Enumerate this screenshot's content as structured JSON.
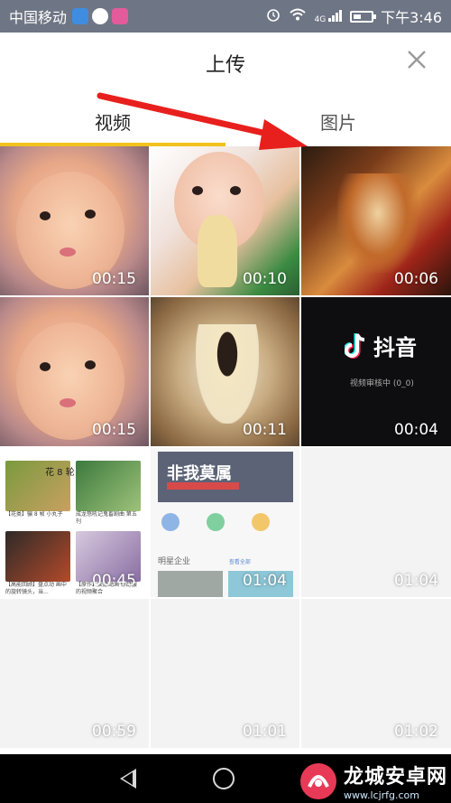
{
  "status_bar": {
    "carrier": "中国移动",
    "time": "下午3:46",
    "network": "4G",
    "icons": [
      "alarm-icon",
      "wifi-icon",
      "signal-icon",
      "battery-icon"
    ],
    "app_icons": [
      "maps-app-icon",
      "chat-app-icon",
      "photo-app-icon"
    ]
  },
  "sheet": {
    "title": "上传",
    "close_icon": "close-icon",
    "tabs": [
      {
        "label": "视频",
        "active": true
      },
      {
        "label": "图片",
        "active": false
      }
    ],
    "accent_color": "#f2c11e",
    "annotation_arrow_color": "#e8201d"
  },
  "videos": [
    {
      "thumb": "baby-face",
      "duration": "00:15"
    },
    {
      "thumb": "baby-banana",
      "duration": "00:10"
    },
    {
      "thumb": "anime-character",
      "duration": "00:06"
    },
    {
      "thumb": "baby-face",
      "duration": "00:15"
    },
    {
      "thumb": "sleeping-baby",
      "duration": "00:11"
    },
    {
      "thumb": "douyin-splash",
      "duration": "00:04"
    },
    {
      "thumb": "app-screenshot-video-list",
      "duration": "00:45"
    },
    {
      "thumb": "app-screenshot-home",
      "duration": "01:04"
    },
    {
      "thumb": "blank",
      "duration": "01:04"
    },
    {
      "thumb": "blank",
      "duration": "00:59"
    },
    {
      "thumb": "blank",
      "duration": "01:01"
    },
    {
      "thumb": "blank",
      "duration": "01:02"
    }
  ],
  "douyin": {
    "name": "抖音",
    "status": "视频审核中 (0_0)"
  },
  "app_screenshot_1": {
    "tag": "花 8 轮",
    "captions": [
      "【花类】骗 8 帧 小丸子",
      "成龙怒吼记鬼畜剧曲 第五刊",
      "【高能回顾】盘点动 画中的旋转镜头，当...",
      "【原作】安静动画 你舒服的视频聚合"
    ]
  },
  "app_screenshot_2": {
    "banner_text": "非我莫属",
    "section_title": "明星企业",
    "section_link": "查看全部"
  },
  "nav_bar": {
    "buttons": [
      "back-icon",
      "home-icon",
      "recent-apps-icon"
    ]
  },
  "watermark": {
    "name": "龙城安卓网",
    "url": "www.lcjrfg.com"
  }
}
